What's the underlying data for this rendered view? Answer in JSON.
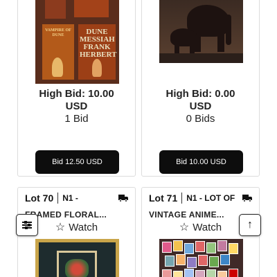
{
  "lots_top": [
    {
      "image": "Dune book covers",
      "high_bid": "High Bid: 10.00",
      "currency": "USD",
      "bid_count": "1 Bid",
      "bid_button": "Bid 12.50 USD",
      "book_titles": [
        "VAMPIRE OF DUNE",
        "DUNE MESSIAH FRANK HERBERT"
      ]
    },
    {
      "image": "carved wooden elephants",
      "high_bid": "High Bid: 0.00",
      "currency": "USD",
      "bid_count": "0 Bids",
      "bid_button": "Bid 10.00 USD"
    }
  ],
  "lots_bottom": [
    {
      "lot_number": "Lot 70",
      "desc_line1": "N1 -",
      "desc_line2": "FRAMED FLORAL...",
      "watch_label": "Watch",
      "shipping_icon": "truck-icon",
      "image": "framed floral artwork"
    },
    {
      "lot_number": "Lot 71",
      "desc_line1": "N1 - LOT OF",
      "desc_line2": "VINTAGE ANIME...",
      "watch_label": "Watch",
      "shipping_icon": "truck-icon",
      "image": "vintage anime cards"
    }
  ],
  "floating": {
    "filter_icon": "sliders-icon",
    "scroll_top_icon": "arrow-up-icon"
  },
  "colors": {
    "button_bg": "#0d0d0d",
    "button_text": "#ffffff",
    "card_border": "#dcdcdc"
  }
}
